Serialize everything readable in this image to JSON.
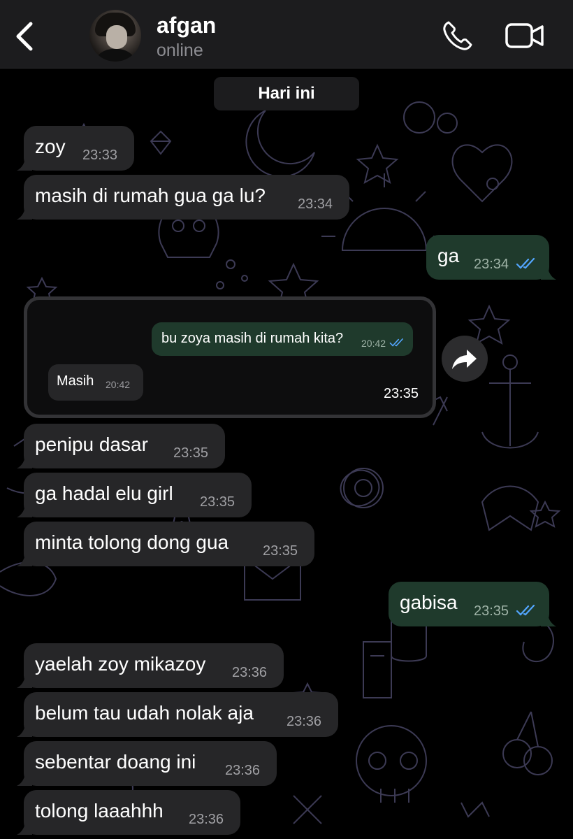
{
  "header": {
    "contact_name": "afgan",
    "contact_status": "online"
  },
  "icons": {
    "back": "chevron-left-icon",
    "call": "phone-icon",
    "video": "video-camera-icon",
    "forward": "forward-arrow-icon",
    "read_receipt": "double-check-icon"
  },
  "colors": {
    "header_bg": "#1c1c1e",
    "incoming_bubble": "#262628",
    "outgoing_bubble": "#1f3a2c",
    "read_tick": "#53a6ff"
  },
  "date_divider": "Hari ini",
  "messages": [
    {
      "text": "zoy",
      "time": "23:33",
      "direction": "in"
    },
    {
      "text": "masih di rumah gua ga lu?",
      "time": "23:34",
      "direction": "in"
    },
    {
      "text": "ga",
      "time": "23:34",
      "direction": "out",
      "read": true
    },
    {
      "text": "penipu dasar",
      "time": "23:35",
      "direction": "in"
    },
    {
      "text": "ga hadal elu girl",
      "time": "23:35",
      "direction": "in"
    },
    {
      "text": "minta tolong dong gua",
      "time": "23:35",
      "direction": "in"
    },
    {
      "text": "gabisa",
      "time": "23:35",
      "direction": "out",
      "read": true
    },
    {
      "text": "yaelah zoy mikazoy",
      "time": "23:36",
      "direction": "in"
    },
    {
      "text": "belum tau udah nolak aja",
      "time": "23:36",
      "direction": "in"
    },
    {
      "text": "sebentar doang ini",
      "time": "23:36",
      "direction": "in"
    },
    {
      "text": "tolong laaahhh",
      "time": "23:36",
      "direction": "in"
    }
  ],
  "forwarded_screenshot": {
    "time": "23:35",
    "outgoing": {
      "text": "bu zoya masih di rumah kita?",
      "time": "20:42",
      "read": true
    },
    "incoming": {
      "text": "Masih",
      "time": "20:42"
    }
  }
}
